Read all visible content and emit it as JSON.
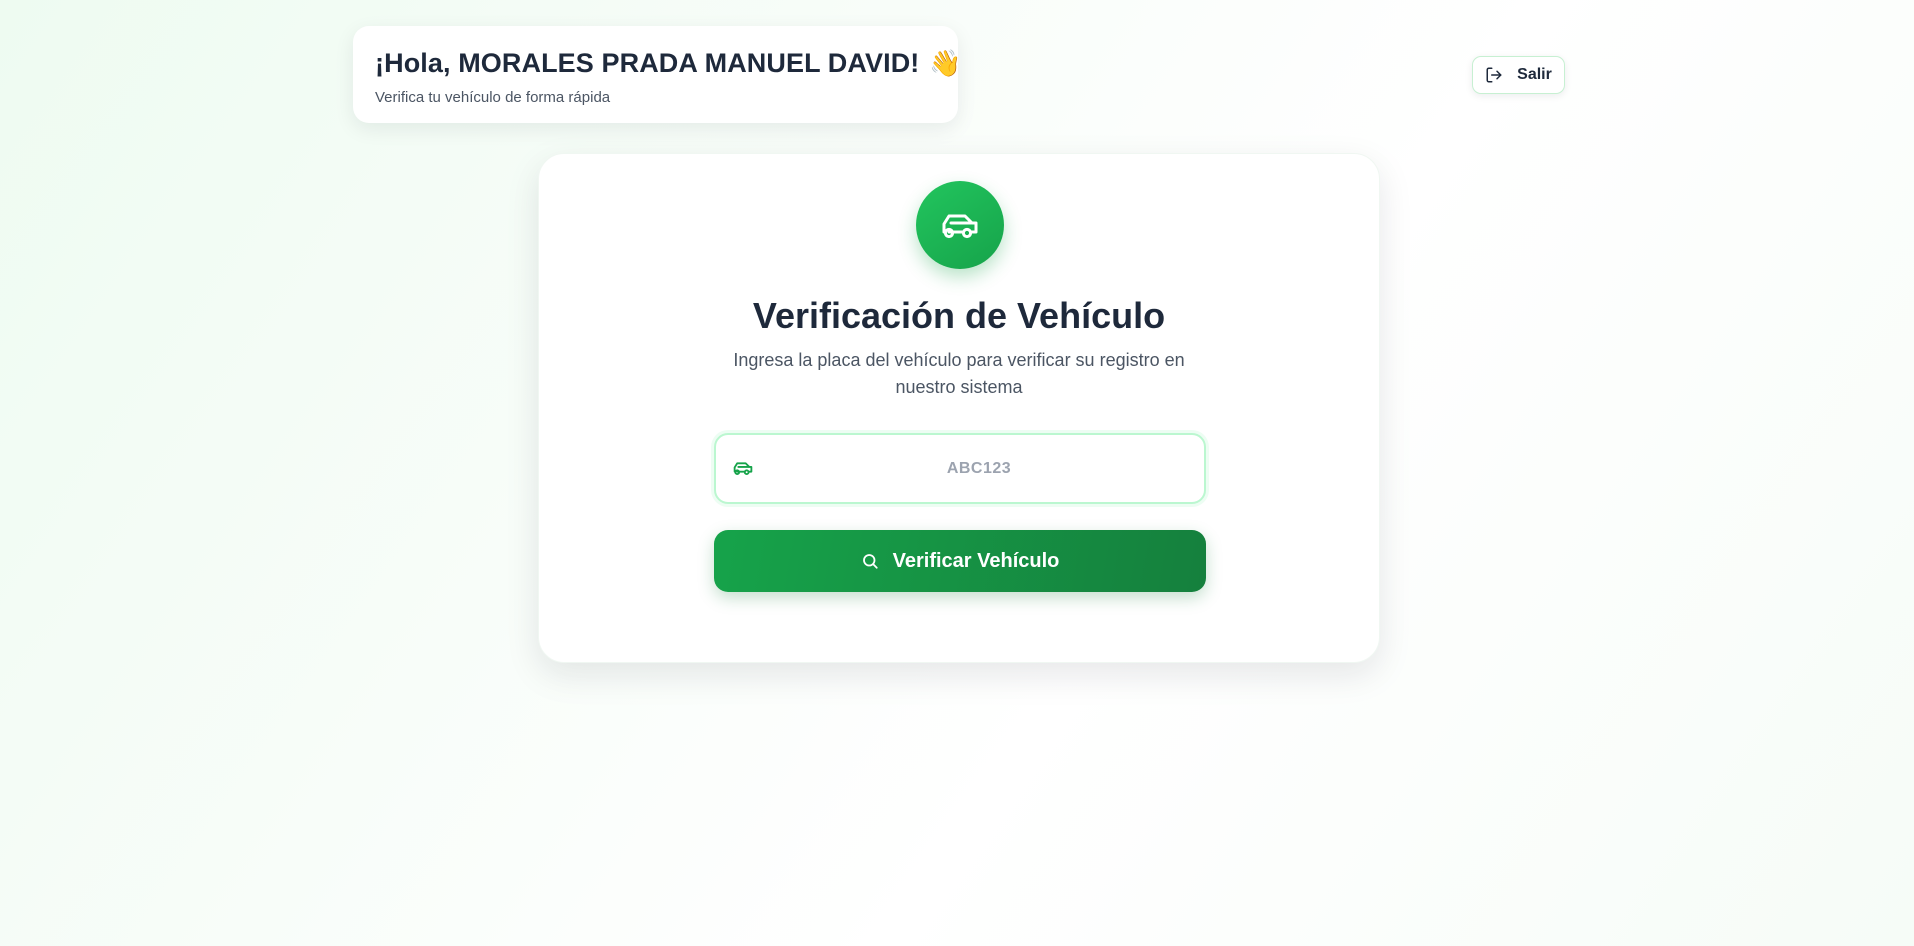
{
  "header": {
    "greeting": "¡Hola, MORALES PRADA MANUEL DAVID!",
    "wave_emoji": "👋",
    "subtitle": "Verifica tu vehículo de forma rápida"
  },
  "logout": {
    "label": "Salir",
    "icon": "logout-icon"
  },
  "verification": {
    "badge_icon": "car-icon",
    "title": "Verificación de Vehículo",
    "description": "Ingresa la placa del vehículo para verificar su registro en nuestro sistema",
    "plate_input": {
      "value": "",
      "placeholder": "ABC123",
      "icon": "car-icon"
    },
    "verify_button": {
      "label": "Verificar Vehículo",
      "icon": "search-icon"
    }
  },
  "colors": {
    "primary_green": "#16a34a",
    "primary_green_dark": "#15803d",
    "badge_green": "#22c55e",
    "input_border": "#bbf7d0",
    "text_dark": "#1e293b",
    "text_muted": "#4b5563"
  }
}
